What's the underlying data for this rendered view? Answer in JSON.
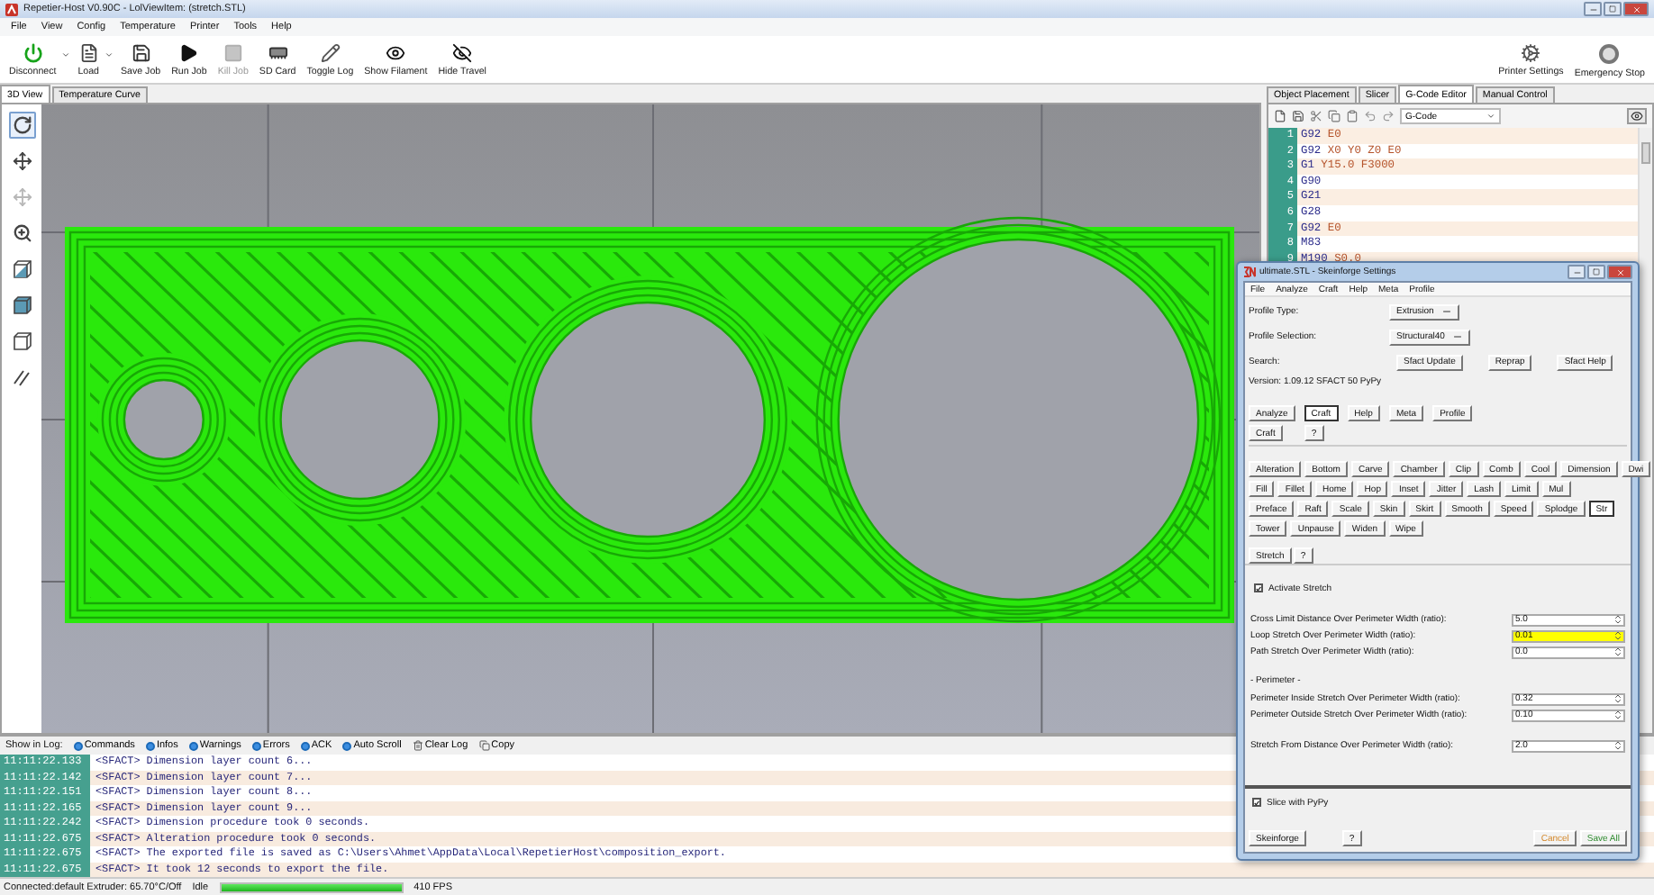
{
  "window": {
    "title": "Repetier-Host V0.90C - LolViewItem: (stretch.STL)"
  },
  "menu": [
    "File",
    "View",
    "Config",
    "Temperature",
    "Printer",
    "Tools",
    "Help"
  ],
  "toolbar": [
    {
      "label": "Disconnect",
      "kind": "power",
      "dropdown": true,
      "disabled": false
    },
    {
      "label": "Load",
      "kind": "load",
      "dropdown": true,
      "disabled": false
    },
    {
      "label": "Save Job",
      "kind": "save",
      "dropdown": false,
      "disabled": false
    },
    {
      "label": "Run Job",
      "kind": "run",
      "dropdown": false,
      "disabled": false
    },
    {
      "label": "Kill Job",
      "kind": "kill",
      "dropdown": false,
      "disabled": true
    },
    {
      "label": "SD Card",
      "kind": "sdcard",
      "dropdown": false,
      "disabled": false
    },
    {
      "label": "Toggle Log",
      "kind": "log",
      "dropdown": false,
      "disabled": false
    },
    {
      "label": "Show Filament",
      "kind": "filament",
      "dropdown": false,
      "disabled": false
    },
    {
      "label": "Hide Travel",
      "kind": "travel",
      "dropdown": false,
      "disabled": false
    }
  ],
  "toolbar_right": [
    {
      "label": "Printer Settings",
      "kind": "gears"
    },
    {
      "label": "Emergency Stop",
      "kind": "stop"
    }
  ],
  "view_tabs": [
    {
      "label": "3D View",
      "selected": true
    },
    {
      "label": "Temperature Curve",
      "selected": false
    }
  ],
  "view_tools": [
    {
      "kind": "rotate",
      "selected": true,
      "disabled": false
    },
    {
      "kind": "move",
      "selected": false,
      "disabled": false
    },
    {
      "kind": "move",
      "selected": false,
      "disabled": true
    },
    {
      "kind": "zoom",
      "selected": false,
      "disabled": false
    },
    {
      "kind": "cube-half",
      "selected": false,
      "disabled": false
    },
    {
      "kind": "cube-full",
      "selected": false,
      "disabled": false
    },
    {
      "kind": "cube-empty",
      "selected": false,
      "disabled": false
    },
    {
      "kind": "lines",
      "selected": false,
      "disabled": false
    }
  ],
  "panel_tabs": [
    {
      "label": "Object Placement",
      "selected": false
    },
    {
      "label": "Slicer",
      "selected": false
    },
    {
      "label": "G-Code Editor",
      "selected": true
    },
    {
      "label": "Manual Control",
      "selected": false
    }
  ],
  "gcode_editor": {
    "mode": "G-Code",
    "lines": [
      {
        "number": "1",
        "code": "G92 E0"
      },
      {
        "number": "2",
        "code": "G92 X0 Y0 Z0 E0"
      },
      {
        "number": "3",
        "code": "G1 Y15.0 F3000"
      },
      {
        "number": "4",
        "code": "G90"
      },
      {
        "number": "5",
        "code": "G21"
      },
      {
        "number": "6",
        "code": "G28"
      },
      {
        "number": "7",
        "code": "G92 E0"
      },
      {
        "number": "8",
        "code": "M83"
      },
      {
        "number": "9",
        "code": "M190 S0.0"
      }
    ]
  },
  "log": {
    "label": "Show in Log:",
    "filters": [
      {
        "label": "Commands",
        "on": true
      },
      {
        "label": "Infos",
        "on": true
      },
      {
        "label": "Warnings",
        "on": true
      },
      {
        "label": "Errors",
        "on": true
      },
      {
        "label": "ACK",
        "on": true
      },
      {
        "label": "Auto Scroll",
        "on": true
      }
    ],
    "actions": [
      {
        "label": "Clear Log",
        "kind": "trash"
      },
      {
        "label": "Copy",
        "kind": "copy"
      }
    ],
    "lines": [
      {
        "time": "11:11:22.133",
        "text": "<SFACT> Dimension layer count 6..."
      },
      {
        "time": "11:11:22.142",
        "text": "<SFACT> Dimension layer count 7..."
      },
      {
        "time": "11:11:22.151",
        "text": "<SFACT> Dimension layer count 8..."
      },
      {
        "time": "11:11:22.165",
        "text": "<SFACT> Dimension layer count 9..."
      },
      {
        "time": "11:11:22.242",
        "text": "<SFACT> Dimension procedure took 0 seconds."
      },
      {
        "time": "11:11:22.675",
        "text": "<SFACT> Alteration procedure took 0 seconds."
      },
      {
        "time": "11:11:22.675",
        "text": "<SFACT> The exported file is saved as C:\\Users\\Ahmet\\AppData\\Local\\RepetierHost\\composition_export."
      },
      {
        "time": "11:11:22.675",
        "text": "<SFACT> It took 12 seconds to export the file."
      }
    ]
  },
  "status_bar": {
    "connection": "Connected:default Extruder: 65.70°C/Off",
    "state": "Idle",
    "progress": {
      "level": 1
    },
    "fps": "410 FPS"
  },
  "dialog": {
    "title": "ultimate.STL - Skeinforge Settings",
    "menu": [
      "File",
      "Analyze",
      "Craft",
      "Help",
      "Meta",
      "Profile"
    ],
    "profile_type": {
      "label": "Profile Type:",
      "value": "Extrusion"
    },
    "profile_selection": {
      "label": "Profile Selection:",
      "value": "Structural40"
    },
    "search": {
      "label": "Search:",
      "buttons": [
        "Sfact Update",
        "Reprap",
        "Sfact Help"
      ]
    },
    "version": "Version: 1.09.12  SFACT 50 PyPy",
    "tabs": [
      {
        "label": "Analyze",
        "selected": false
      },
      {
        "label": "Craft",
        "selected": true
      },
      {
        "label": "Help",
        "selected": false
      },
      {
        "label": "Meta",
        "selected": false
      },
      {
        "label": "Profile",
        "selected": false
      }
    ],
    "section": {
      "label": "Craft",
      "help": "?"
    },
    "plugin_rows": [
      [
        {
          "label": "Alteration",
          "selected": false
        },
        {
          "label": "Bottom",
          "selected": false
        },
        {
          "label": "Carve",
          "selected": false
        },
        {
          "label": "Chamber",
          "selected": false
        },
        {
          "label": "Clip",
          "selected": false
        },
        {
          "label": "Comb",
          "selected": false
        },
        {
          "label": "Cool",
          "selected": false
        },
        {
          "label": "Dimension",
          "selected": false
        },
        {
          "label": "Dwi",
          "selected": false
        }
      ],
      [
        {
          "label": "Fill",
          "selected": false
        },
        {
          "label": "Fillet",
          "selected": false
        },
        {
          "label": "Home",
          "selected": false
        },
        {
          "label": "Hop",
          "selected": false
        },
        {
          "label": "Inset",
          "selected": false
        },
        {
          "label": "Jitter",
          "selected": false
        },
        {
          "label": "Lash",
          "selected": false
        },
        {
          "label": "Limit",
          "selected": false
        },
        {
          "label": "Mul",
          "selected": false
        }
      ],
      [
        {
          "label": "Preface",
          "selected": false
        },
        {
          "label": "Raft",
          "selected": false
        },
        {
          "label": "Scale",
          "selected": false
        },
        {
          "label": "Skin",
          "selected": false
        },
        {
          "label": "Skirt",
          "selected": false
        },
        {
          "label": "Smooth",
          "selected": false
        },
        {
          "label": "Speed",
          "selected": false
        },
        {
          "label": "Splodge",
          "selected": false
        },
        {
          "label": "Str",
          "selected": true
        }
      ],
      [
        {
          "label": "Tower",
          "selected": false
        },
        {
          "label": "Unpause",
          "selected": false
        },
        {
          "label": "Widen",
          "selected": false
        },
        {
          "label": "Wipe",
          "selected": false
        }
      ]
    ],
    "plugin": {
      "label": "Stretch",
      "help": "?"
    },
    "activate": {
      "label": "Activate Stretch",
      "checked": true
    },
    "settings_groups": [
      [
        {
          "kind": "field",
          "label": "Cross Limit Distance Over Perimeter Width (ratio):",
          "value": "5.0",
          "highlighted": false
        },
        {
          "kind": "field",
          "label": "Loop Stretch Over Perimeter Width (ratio):",
          "value": "0.01",
          "highlighted": true
        },
        {
          "kind": "field",
          "label": "Path Stretch Over Perimeter Width (ratio):",
          "value": "0.0",
          "highlighted": false
        }
      ],
      [
        {
          "kind": "heading",
          "label": "- Perimeter -"
        },
        {
          "kind": "field",
          "label": "Perimeter Inside Stretch Over Perimeter Width (ratio):",
          "value": "0.32",
          "highlighted": false
        },
        {
          "kind": "field",
          "label": "Perimeter Outside Stretch Over Perimeter Width (ratio):",
          "value": "0.10",
          "highlighted": false
        }
      ],
      [
        {
          "kind": "field",
          "label": "Stretch From Distance Over Perimeter Width (ratio):",
          "value": "2.0",
          "highlighted": false
        }
      ]
    ],
    "slice_pypy": {
      "label": "Slice with PyPy",
      "checked": true
    },
    "footer": {
      "left": "Skeinforge",
      "help": "?",
      "cancel": "Cancel",
      "save": "Save All"
    }
  }
}
